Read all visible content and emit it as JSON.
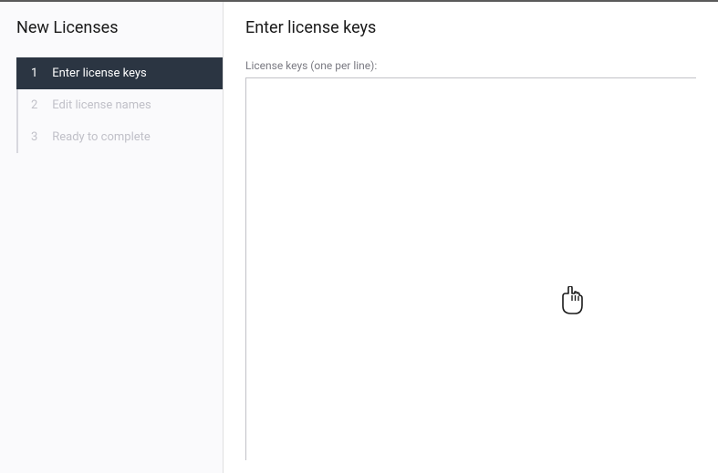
{
  "sidebar": {
    "title": "New Licenses",
    "steps": [
      {
        "num": "1",
        "label": "Enter license keys",
        "active": true
      },
      {
        "num": "2",
        "label": "Edit license names",
        "active": false
      },
      {
        "num": "3",
        "label": "Ready to complete",
        "active": false
      }
    ]
  },
  "main": {
    "title": "Enter license keys",
    "field_label": "License keys (one per line):",
    "textarea_value": ""
  }
}
